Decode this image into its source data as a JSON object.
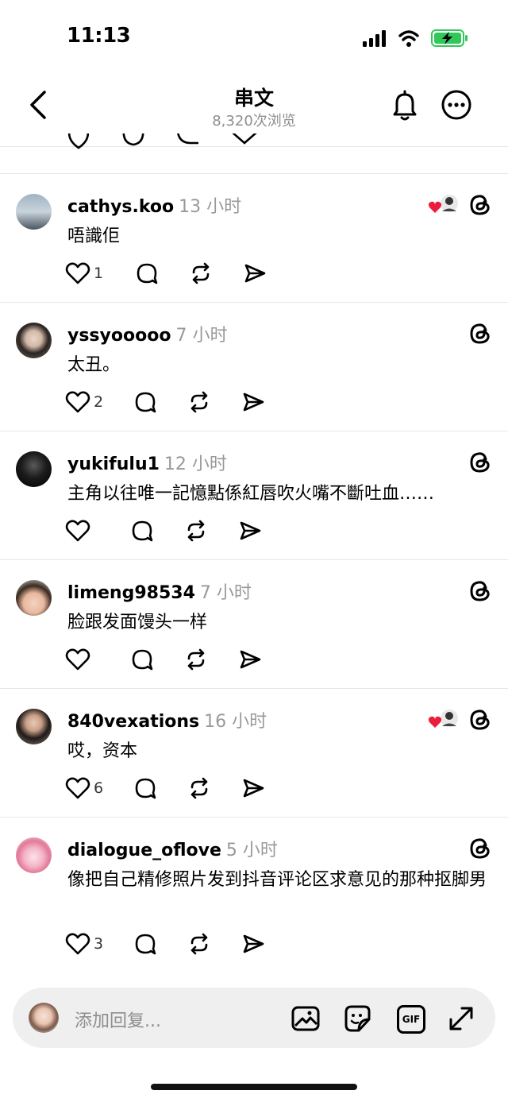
{
  "status_bar": {
    "time": "11:13",
    "battery_color": "#33c759"
  },
  "nav": {
    "title": "串文",
    "subtitle": "8,320次浏览",
    "back_icon": "chevron-left-icon",
    "bell_icon": "bell-icon",
    "more_icon": "more-icon"
  },
  "comments": [
    {
      "username": "cathys.koo",
      "time": "13 小时",
      "text": "唔識佢",
      "likes": "1",
      "liked_by_author": true
    },
    {
      "username": "yssyooooo",
      "time": "7 小时",
      "text": "太丑。",
      "likes": "2",
      "liked_by_author": false
    },
    {
      "username": "yukifulu1",
      "time": "12 小时",
      "text": "主角以往唯一記憶點係紅唇吹火嘴不斷吐血……",
      "likes": "",
      "liked_by_author": false
    },
    {
      "username": "limeng98534",
      "time": "7 小时",
      "text": "脸跟发面馒头一样",
      "likes": "",
      "liked_by_author": false
    },
    {
      "username": "840vexations",
      "time": "16 小时",
      "text": "哎，资本",
      "likes": "6",
      "liked_by_author": true
    },
    {
      "username": "dialogue_oflove",
      "time": "5 小时",
      "text": "像把自己精修照片发到抖音评论区求意见的那种抠脚男",
      "likes": "3",
      "liked_by_author": false
    }
  ],
  "reply_bar": {
    "placeholder": "添加回复...",
    "gif_label": "GIF"
  },
  "colors": {
    "like_heart": "#ed1c3c",
    "muted": "#999999"
  }
}
